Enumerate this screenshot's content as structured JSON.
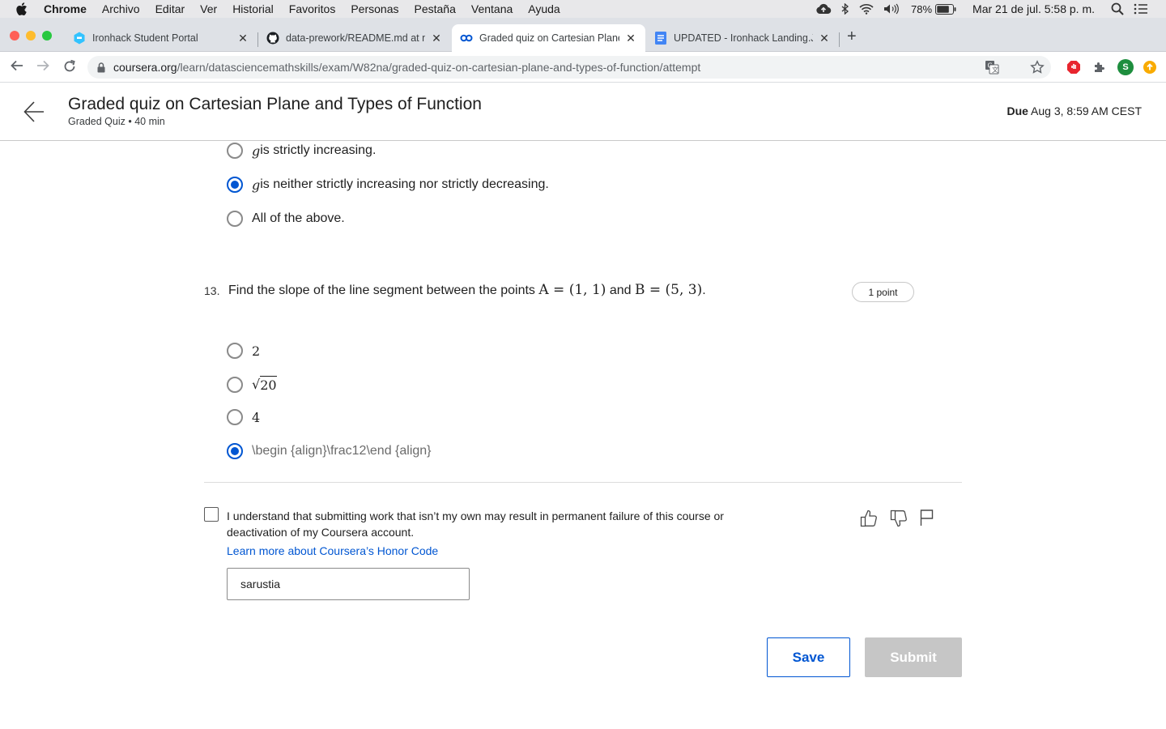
{
  "menubar": {
    "app": "Chrome",
    "items": [
      "Archivo",
      "Editar",
      "Ver",
      "Historial",
      "Favoritos",
      "Personas",
      "Pestaña",
      "Ventana",
      "Ayuda"
    ],
    "battery": "78%",
    "datetime": "Mar 21 de jul.  5:58 p. m."
  },
  "tabs": [
    {
      "title": "Ironhack Student Portal",
      "favicon": "ironhack-icon"
    },
    {
      "title": "data-prework/README.md at m",
      "favicon": "github-icon"
    },
    {
      "title": "Graded quiz on Cartesian Plane",
      "favicon": "coursera-icon",
      "active": true
    },
    {
      "title": "UPDATED - Ironhack Landing.Ja",
      "favicon": "docs-icon"
    }
  ],
  "address": {
    "host": "coursera.org",
    "path": "/learn/datasciencemathskills/exam/W82na/graded-quiz-on-cartesian-plane-and-types-of-function/attempt"
  },
  "extensions": {
    "profile_initial": "S"
  },
  "header": {
    "title": "Graded quiz on Cartesian Plane and Types of Function",
    "subtitle": "Graded Quiz • 40 min",
    "due_label": "Due",
    "due_value": "Aug 3, 8:59 AM CEST"
  },
  "prev_question": {
    "options": [
      {
        "var": "g",
        "text": " is strictly increasing.",
        "checked": false
      },
      {
        "var": "g",
        "text": " is neither strictly increasing nor strictly decreasing.",
        "checked": true
      },
      {
        "var": "",
        "text": "All of the above.",
        "checked": false
      }
    ]
  },
  "question13": {
    "number": "13.",
    "text_prefix": "Find the slope of the line segment between the points ",
    "point_a": "A = (1, 1)",
    "text_and": " and ",
    "point_b": "B = (5, 3)",
    "text_suffix": ".",
    "points": "1 point",
    "options": [
      {
        "text": "2",
        "checked": false
      },
      {
        "text": "20",
        "sqrt": true,
        "checked": false
      },
      {
        "text": "4",
        "checked": false
      },
      {
        "text": "\\begin {align}\\frac12\\end {align}",
        "checked": true,
        "raw": true
      }
    ]
  },
  "honor": {
    "text": "I understand that submitting work that isn’t my own may result in permanent failure of this course or deactivation of my Coursera account.",
    "link": "Learn more about Coursera’s Honor Code",
    "name_value": "sarustia",
    "checked": false
  },
  "buttons": {
    "save": "Save",
    "submit": "Submit"
  },
  "colors": {
    "accent": "#0056d2",
    "disabled": "#c6c6c6"
  }
}
